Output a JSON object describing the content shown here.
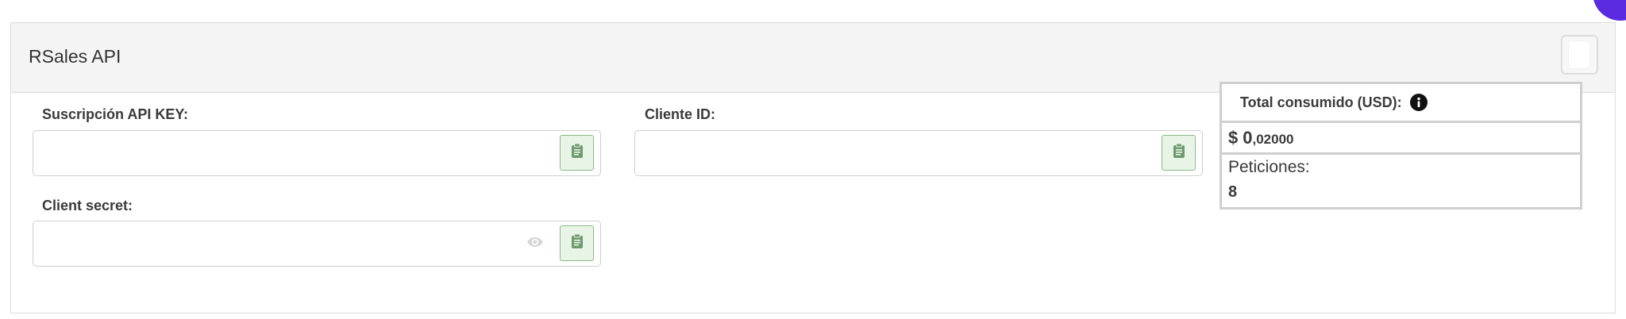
{
  "card": {
    "title": "RSales API"
  },
  "fields": {
    "api_key": {
      "label": "Suscripción API KEY:",
      "value": "",
      "placeholder": ""
    },
    "client_id": {
      "label": "Cliente ID:",
      "value": "",
      "placeholder": ""
    },
    "client_secret": {
      "label": "Client secret:",
      "value": "",
      "placeholder": ""
    }
  },
  "stats": {
    "total_label": "Total consumido (USD):",
    "currency": "$",
    "amount_int": "0",
    "amount_dec": ",02000",
    "requests_label": "Peticiones:",
    "requests_value": "8"
  },
  "icons": {
    "copy": "clipboard-icon",
    "eye": "eye-icon",
    "info": "info-icon"
  },
  "colors": {
    "accent_blob": "#5b2be0",
    "copy_button_bg": "#e8f5e6",
    "copy_button_border": "#8ab98a",
    "copy_icon": "#6f9a6f",
    "header_bg": "#f4f4f4",
    "border": "#cfcfcf"
  }
}
